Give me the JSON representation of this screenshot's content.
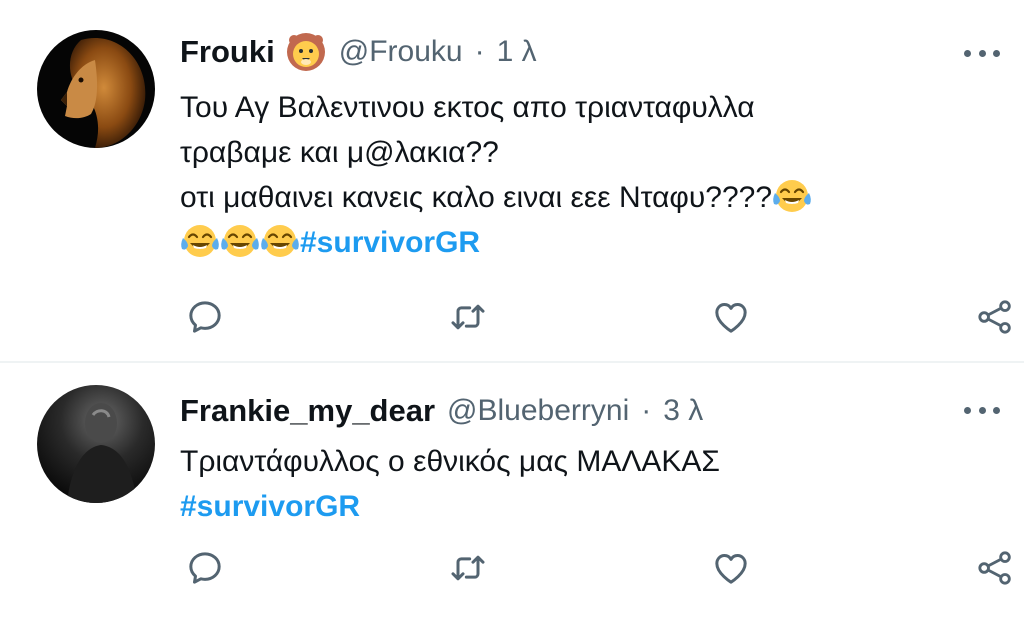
{
  "tweets": [
    {
      "display_name": "Frouki",
      "name_emoji": "lion-face-emoji",
      "handle": "@Frouku",
      "separator": "·",
      "time": "1 λ",
      "lines": [
        "Του Αγ Βαλεντινου εκτος απο τριανταφυλλα",
        "τραβαμε και μ@λακια??",
        "οτι μαθαινει κανεις καλο ειναι εεε Νταφυ????"
      ],
      "hashtag": "#survivorGR",
      "avatar": "lion-photo"
    },
    {
      "display_name": "Frankie_my_dear",
      "handle": "@Blueberryni",
      "separator": "·",
      "time": "3 λ",
      "lines": [
        "Τριαντάφυλλος ο εθνικός μας ΜΑΛΑΚΑΣ"
      ],
      "hashtag": "#survivorGR",
      "avatar": "dark-person-photo"
    }
  ],
  "icons": {
    "reply": "reply-icon",
    "retweet": "retweet-icon",
    "like": "heart-icon",
    "share": "share-icon",
    "more": "more-dots-icon"
  },
  "colors": {
    "text": "#0f1419",
    "secondary": "#536471",
    "hashtag": "#1d9bf0",
    "divider": "#eff3f4"
  }
}
